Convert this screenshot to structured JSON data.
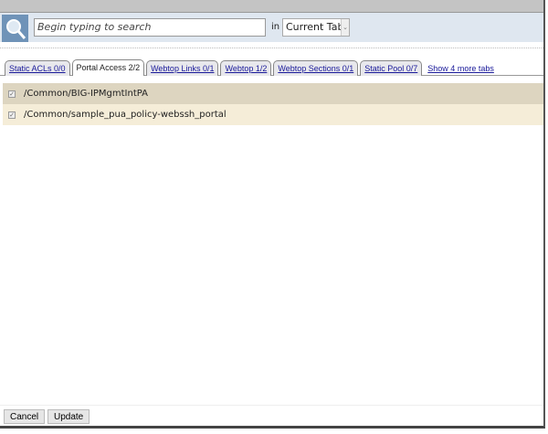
{
  "search": {
    "placeholder": "Begin typing to search",
    "in_label": "in",
    "scope": "Current Tab"
  },
  "tabs": [
    {
      "label": "Static ACLs 0/0",
      "active": false
    },
    {
      "label": "Portal Access 2/2",
      "active": true
    },
    {
      "label": "Webtop Links 0/1",
      "active": false
    },
    {
      "label": "Webtop 1/2",
      "active": false
    },
    {
      "label": "Webtop Sections 0/1",
      "active": false
    },
    {
      "label": "Static Pool 0/7",
      "active": false
    }
  ],
  "more_tabs": "Show 4 more tabs",
  "rows": [
    {
      "label": "/Common/BIG-IPMgmtIntPA",
      "color": "#ddd5c0"
    },
    {
      "label": "/Common/sample_pua_policy-webssh_portal",
      "color": "#f5edd8"
    }
  ],
  "buttons": {
    "cancel": "Cancel",
    "update": "Update"
  }
}
